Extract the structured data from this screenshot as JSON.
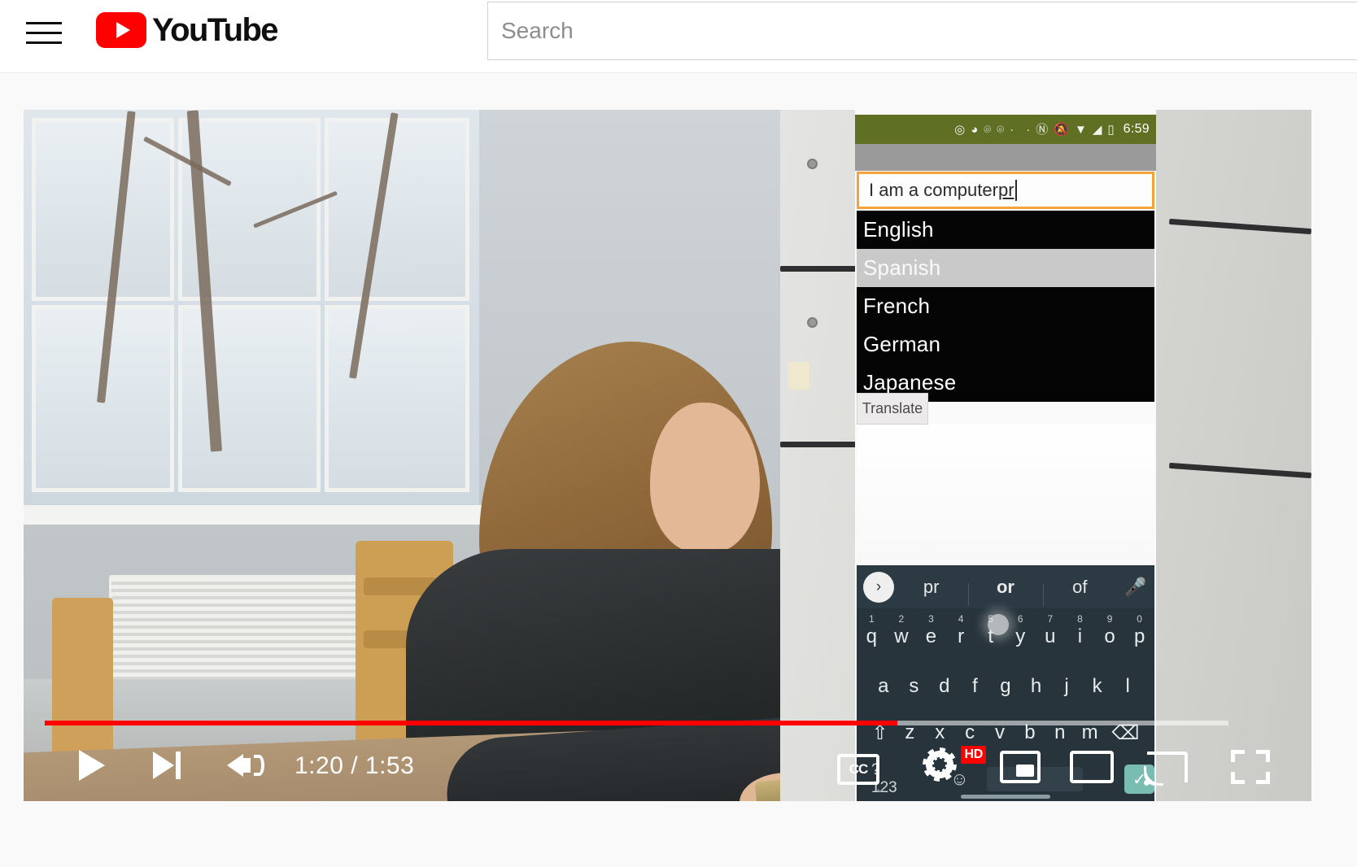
{
  "header": {
    "menu_icon": "hamburger-menu-icon",
    "logo_text": "YouTube",
    "logo_icon": "youtube-play-icon",
    "search": {
      "placeholder": "Search",
      "value": ""
    }
  },
  "player": {
    "time_display": "1:20 / 1:53",
    "current_time": "1:20",
    "duration": "1:53",
    "progress_percent": 72,
    "controls": {
      "play_label": "Play",
      "next_label": "Next video",
      "volume_label": "Mute",
      "captions_label": "CC",
      "settings_label": "Settings",
      "quality_badge": "HD",
      "pip_label": "Miniplayer",
      "theater_label": "Theater mode",
      "cast_label": "Play on TV",
      "fullscreen_label": "Full screen"
    }
  },
  "phone": {
    "status_bar": {
      "time": "6:59",
      "icons": [
        "camera-icon",
        "messenger-icon",
        "chat-icon",
        "chat-icon",
        "dot-icon",
        "dot-icon",
        "nfc-icon",
        "mute-icon",
        "wifi-icon",
        "signal-icon",
        "battery-icon"
      ]
    },
    "text_field": {
      "value": "I am a computer ",
      "typed_tail": "pr"
    },
    "languages": [
      {
        "label": "English",
        "style": "dark"
      },
      {
        "label": "Spanish",
        "style": "light"
      },
      {
        "label": "French",
        "style": "dark"
      },
      {
        "label": "German",
        "style": "dark"
      },
      {
        "label": "Japanese",
        "style": "dark"
      }
    ],
    "translate_button": "Translate",
    "keyboard": {
      "suggestions": [
        "pr",
        "or",
        "of"
      ],
      "chevron_icon": "chevron-right-icon",
      "mic_icon": "microphone-icon",
      "row1": [
        {
          "key": "q",
          "num": "1"
        },
        {
          "key": "w",
          "num": "2"
        },
        {
          "key": "e",
          "num": "3"
        },
        {
          "key": "r",
          "num": "4"
        },
        {
          "key": "t",
          "num": "5"
        },
        {
          "key": "y",
          "num": "6"
        },
        {
          "key": "u",
          "num": "7"
        },
        {
          "key": "i",
          "num": "8"
        },
        {
          "key": "o",
          "num": "9"
        },
        {
          "key": "p",
          "num": "0"
        }
      ],
      "row2": [
        "a",
        "s",
        "d",
        "f",
        "g",
        "h",
        "j",
        "k",
        "l"
      ],
      "row3": [
        "z",
        "x",
        "c",
        "v",
        "b",
        "n",
        "m"
      ],
      "shift_icon": "shift-up-icon",
      "backspace_icon": "backspace-icon",
      "symbols_key": "?123",
      "emoji_icon": "emoji-smiley-icon",
      "period_key": ".",
      "enter_icon": "check-enter-icon"
    }
  },
  "colors": {
    "youtube_red": "#ff0000",
    "progress_red": "#ff0000",
    "phone_accent_orange": "#f3a33a",
    "status_bar_green": "#5f6f23",
    "keyboard_dark": "#27343c",
    "enter_key_teal": "#79bdb2"
  }
}
